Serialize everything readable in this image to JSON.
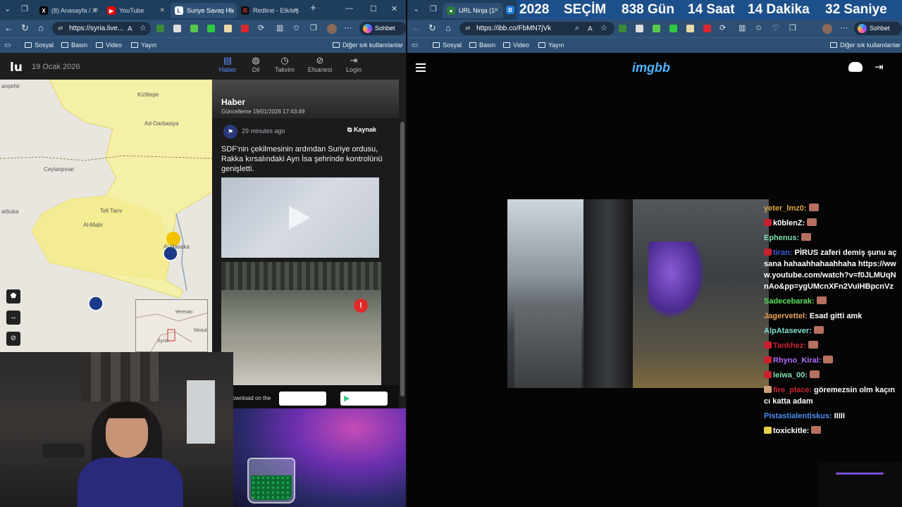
{
  "left_browser": {
    "tabs": [
      {
        "label": "(8) Anasayfa / X"
      },
      {
        "label": "YouTube"
      },
      {
        "label": "Suriye Savaş Ha"
      },
      {
        "label": "Redline - Etkileş"
      }
    ],
    "address": "https://syria.live...",
    "copilot_label": "Sohbet et",
    "bookmarks": [
      "Sosyal",
      "Basın",
      "Video",
      "Yayın"
    ],
    "other_bookmarks": "Diğer sık kullanılanlar"
  },
  "liveuamap": {
    "logo": "lu",
    "date": "19 Ocak 2026",
    "nav": [
      {
        "label": "Haber",
        "icon": "document-icon",
        "active": true
      },
      {
        "label": "Dil",
        "icon": "globe-icon"
      },
      {
        "label": "Takvim",
        "icon": "clock-icon"
      },
      {
        "label": "Efsanesi",
        "icon": "compass-icon"
      },
      {
        "label": "Login",
        "icon": "login-icon"
      }
    ],
    "map_labels": [
      "anşehir",
      "Kiziltepe",
      "Ad-Darbasiya",
      "Ceylanpınar",
      "arbuka",
      "Al-Mabr",
      "Tell Tamr",
      "Al-Hasaka",
      "Syria",
      "Mosul",
      "Yerevan",
      "Sulay"
    ],
    "news": {
      "title": "Haber",
      "updated": "Güncelleme 19/01/2026 17:43:49",
      "item_time": "29 minutes ago",
      "source_label": "Kaynak",
      "text": "SDF'nin çekilmesinin ardından Suriye ordusu, Rakka kırsalındaki Ayn İsa şehrinde kontrolünü genişletti."
    },
    "download_text": "ownload on the"
  },
  "right_browser": {
    "tab_label": "URL Ninja (1",
    "address": "https://ibb.co/FbMN7jVk",
    "copilot_label": "Sohbet et",
    "bookmarks": [
      "Sosyal",
      "Basın",
      "Video",
      "Yayın"
    ],
    "other_bookmarks": "Diğer sık kullanılanlar"
  },
  "countdown": {
    "year": "2028",
    "label": "SEÇİM",
    "days": "838 Gün",
    "hours": "14 Saat",
    "minutes": "14 Dakika",
    "seconds": "32 Saniye"
  },
  "imgbb": {
    "logo": "imgbb"
  },
  "chat": [
    {
      "user": "yeter_lmz0:",
      "user_color": "#d9a441",
      "text": "",
      "emote": true,
      "badge": ""
    },
    {
      "user": "k0blenZ:",
      "user_color": "#ffffff",
      "text": "",
      "emote": true,
      "badge": "#c8202e"
    },
    {
      "user": "Ephenus:",
      "user_color": "#7ee0b3",
      "text": "",
      "emote": true,
      "badge": ""
    },
    {
      "user": "tiran:",
      "user_color": "#3a5bd8",
      "text": "PİRUS zaferi demiş şunu açsana hahaahhahaahhaha https://www.youtube.com/watch?v=f0JLMUqNnAo&pp=ygUMcnXFn2VuIHBpcnVz",
      "emote": false,
      "badge": "#c8202e"
    },
    {
      "user": "Sadecebarak:",
      "user_color": "#5be15b",
      "text": "",
      "emote": true,
      "badge": ""
    },
    {
      "user": "Jagervettel:",
      "user_color": "#e8a25a",
      "text": "Esad gitti amk",
      "emote": false,
      "badge": ""
    },
    {
      "user": "AlpAtasever:",
      "user_color": "#7ee0d0",
      "text": "",
      "emote": true,
      "badge": ""
    },
    {
      "user": "Tankhez:",
      "user_color": "#c8202e",
      "text": "",
      "emote": true,
      "badge": "#c8202e"
    },
    {
      "user": "Rhyno_Kiral:",
      "user_color": "#b36bff",
      "text": "",
      "emote": true,
      "badge": "#c8202e"
    },
    {
      "user": "leiwa_00:",
      "user_color": "#7ee0b3",
      "text": "",
      "emote": true,
      "badge": "#c8202e"
    },
    {
      "user": "fire_place:",
      "user_color": "#c8202e",
      "text": "göremezsin olm kaçıncı katta adam",
      "emote": false,
      "badge": "#c9a27a"
    },
    {
      "user": "Pistastialentiskus:",
      "user_color": "#4c8ef0",
      "text": "IIIII",
      "emote": false,
      "badge": ""
    },
    {
      "user": "toxickitle:",
      "user_color": "#ffffff",
      "text": "",
      "emote": true,
      "badge": "#e6d24a"
    }
  ]
}
